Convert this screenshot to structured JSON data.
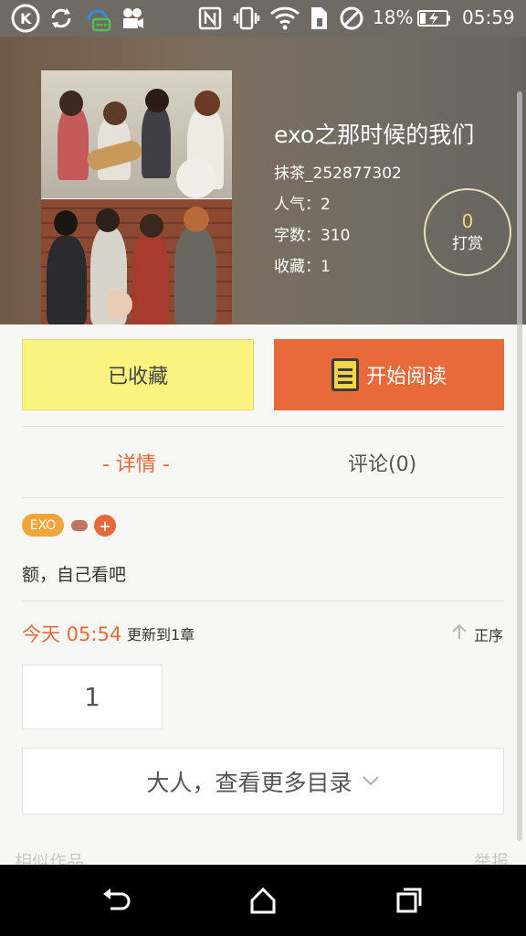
{
  "status_bar": {
    "battery_percent": "18%",
    "time": "05:59",
    "icons": [
      "k-app-icon",
      "sync-icon",
      "chat-bot-icon",
      "camera-video-icon",
      "nfc-icon",
      "vibrate-icon",
      "wifi-icon",
      "sim-icon",
      "do-not-disturb-icon",
      "battery-charging-icon"
    ]
  },
  "book": {
    "title": "exo之那时候的我们",
    "author": "抹茶_252877302",
    "popularity": "人气：2",
    "word_count": "字数：310",
    "favorites": "收藏：1"
  },
  "reward": {
    "count": "0",
    "label": "打赏"
  },
  "actions": {
    "favorited_label": "已收藏",
    "read_label": "开始阅读"
  },
  "tabs": {
    "detail": "- 详情 -",
    "comments": "评论(0)"
  },
  "tags": {
    "first": "EXO",
    "add": "+"
  },
  "description": "额，自己看吧",
  "update": {
    "time": "今天 05:54",
    "text": "更新到1章",
    "sort_label": "正序"
  },
  "chapters": [
    "1"
  ],
  "more_catalog": "大人，查看更多目录",
  "footer": {
    "similar": "相似作品",
    "report": "举报"
  },
  "colors": {
    "accent": "#e8693a",
    "favorite_bg": "#fbf380",
    "tag": "#f3a539"
  }
}
